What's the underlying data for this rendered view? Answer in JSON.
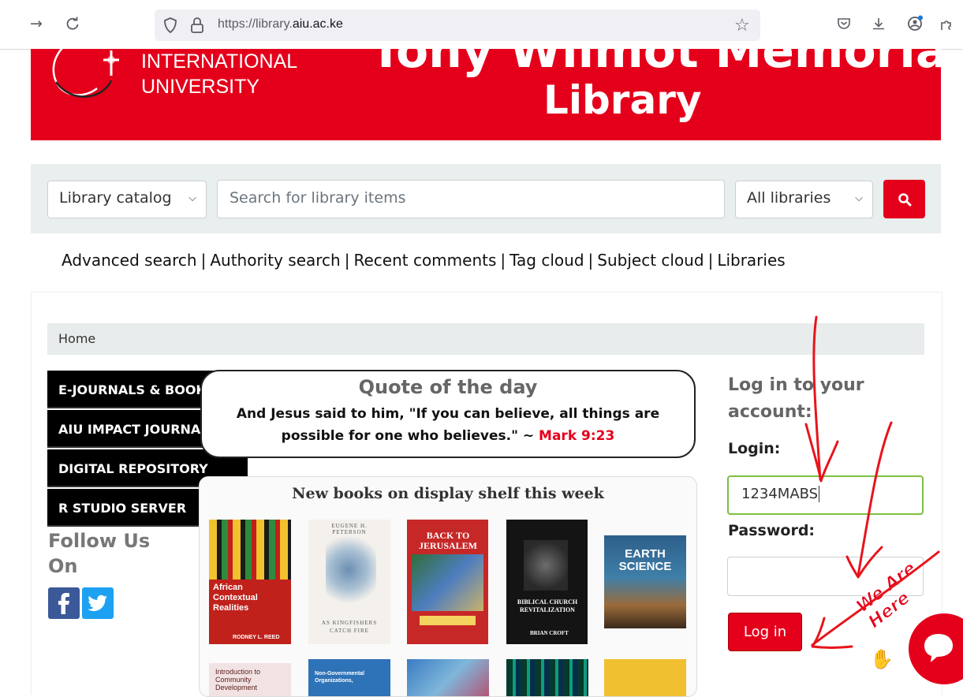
{
  "browser": {
    "url_prefix": "https://library.",
    "url_domain": "aiu.ac.ke"
  },
  "banner": {
    "org_line1": "INTERNATIONAL",
    "org_line2": "UNIVERSITY",
    "title_top": "Tony Wilmot Memorial",
    "title": "Library"
  },
  "search": {
    "catalog_select": "Library catalog",
    "placeholder": "Search for library items",
    "libraries_select": "All libraries"
  },
  "links": [
    "Advanced search",
    "Authority search",
    "Recent comments",
    "Tag cloud",
    "Subject cloud",
    "Libraries"
  ],
  "breadcrumb": "Home",
  "menu": [
    "E-JOURNALS & BOOKS",
    "AIU IMPACT JOURNAL",
    "DIGITAL REPOSITORY",
    "R STUDIO SERVER"
  ],
  "follow": {
    "line1": "Follow Us",
    "line2": "On"
  },
  "quote": {
    "title": "Quote of the day",
    "text": "And Jesus said to him, \"If you can believe, all things are possible for one who believes.\" ~",
    "ref": "Mark 9:23"
  },
  "books": {
    "title": "New books on display shelf this week",
    "items": [
      {
        "title": "African Contextual Realities",
        "author": "RODNEY L. REED"
      },
      {
        "title": "AS KINGFISHERS CATCH FIRE",
        "author": "EUGENE H. PETERSON"
      },
      {
        "title": "BACK TO JERUSALEM",
        "author": ""
      },
      {
        "title": "BIBLICAL CHURCH REVITALIZATION",
        "author": "BRIAN CROFT"
      },
      {
        "title": "EARTH SCIENCE",
        "author": ""
      },
      {
        "title": "Introduction to Community Development",
        "author": ""
      },
      {
        "title": "Non-Governmental Organizations,",
        "author": ""
      }
    ]
  },
  "login": {
    "heading": "Log in to your account:",
    "login_label": "Login:",
    "login_value": "1234MABS",
    "password_label": "Password:",
    "button": "Log in"
  },
  "chat": {
    "text": "We Are Here"
  },
  "colors": {
    "brand_red": "#e4001b",
    "annotation_red": "#e8141b"
  }
}
